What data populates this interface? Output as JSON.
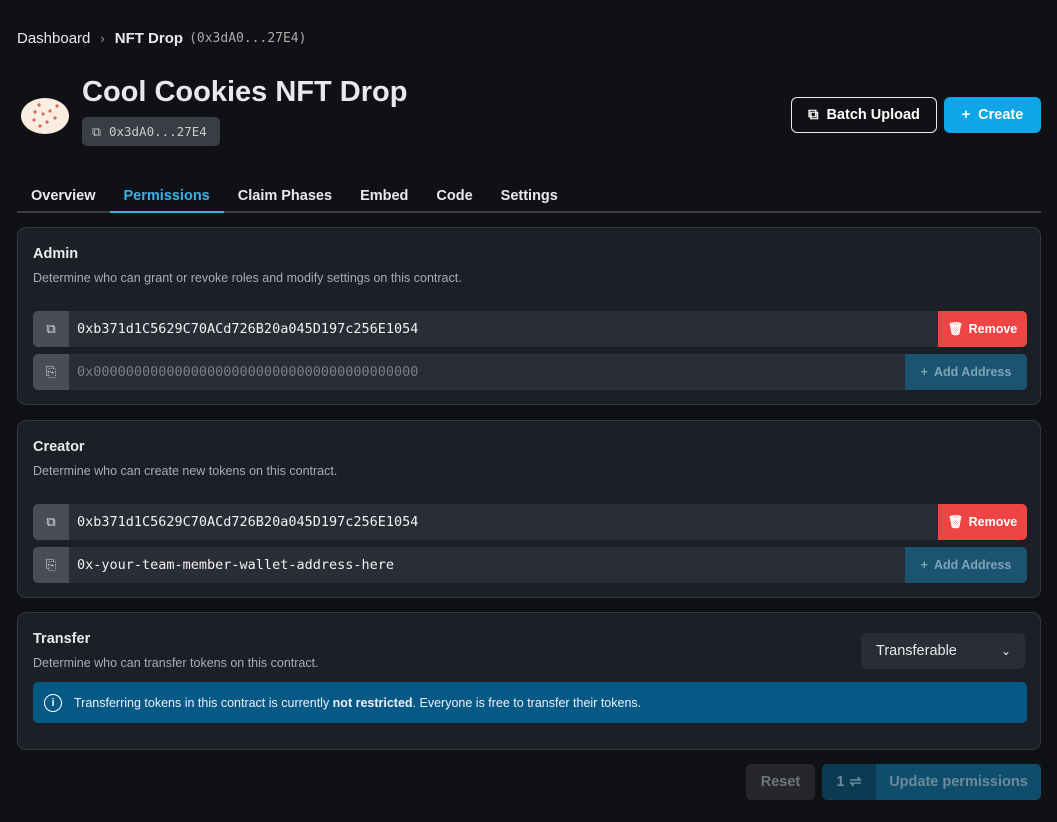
{
  "breadcrumb": {
    "root": "Dashboard",
    "current": "NFT Drop",
    "address": "(0x3dA0...27E4)"
  },
  "header": {
    "title": "Cool Cookies NFT Drop",
    "address": "0x3dA0...27E4",
    "batch_upload": "Batch Upload",
    "create": "Create"
  },
  "tabs": [
    {
      "label": "Overview"
    },
    {
      "label": "Permissions",
      "active": true
    },
    {
      "label": "Claim Phases"
    },
    {
      "label": "Embed"
    },
    {
      "label": "Code"
    },
    {
      "label": "Settings"
    }
  ],
  "admin": {
    "title": "Admin",
    "description": "Determine who can grant or revoke roles and modify settings on this contract.",
    "address": "0xb371d1C5629C70ACd726B20a045D197c256E1054",
    "remove": "Remove",
    "placeholder": "0x0000000000000000000000000000000000000000",
    "add": "Add Address"
  },
  "creator": {
    "title": "Creator",
    "description": "Determine who can create new tokens on this contract.",
    "address": "0xb371d1C5629C70ACd726B20a045D197c256E1054",
    "remove": "Remove",
    "input_value": "0x-your-team-member-wallet-address-here",
    "add": "Add Address"
  },
  "transfer": {
    "title": "Transfer",
    "description": "Determine who can transfer tokens on this contract.",
    "select_value": "Transferable",
    "info_pre": "Transferring tokens in this contract is currently ",
    "info_bold": "not restricted",
    "info_post": ". Everyone is free to transfer their tokens."
  },
  "footer": {
    "reset": "Reset",
    "change_count": "1",
    "update": "Update permissions"
  },
  "colors": {
    "accent": "#0ea5e9",
    "danger": "#ef4444",
    "info": "#075985"
  }
}
